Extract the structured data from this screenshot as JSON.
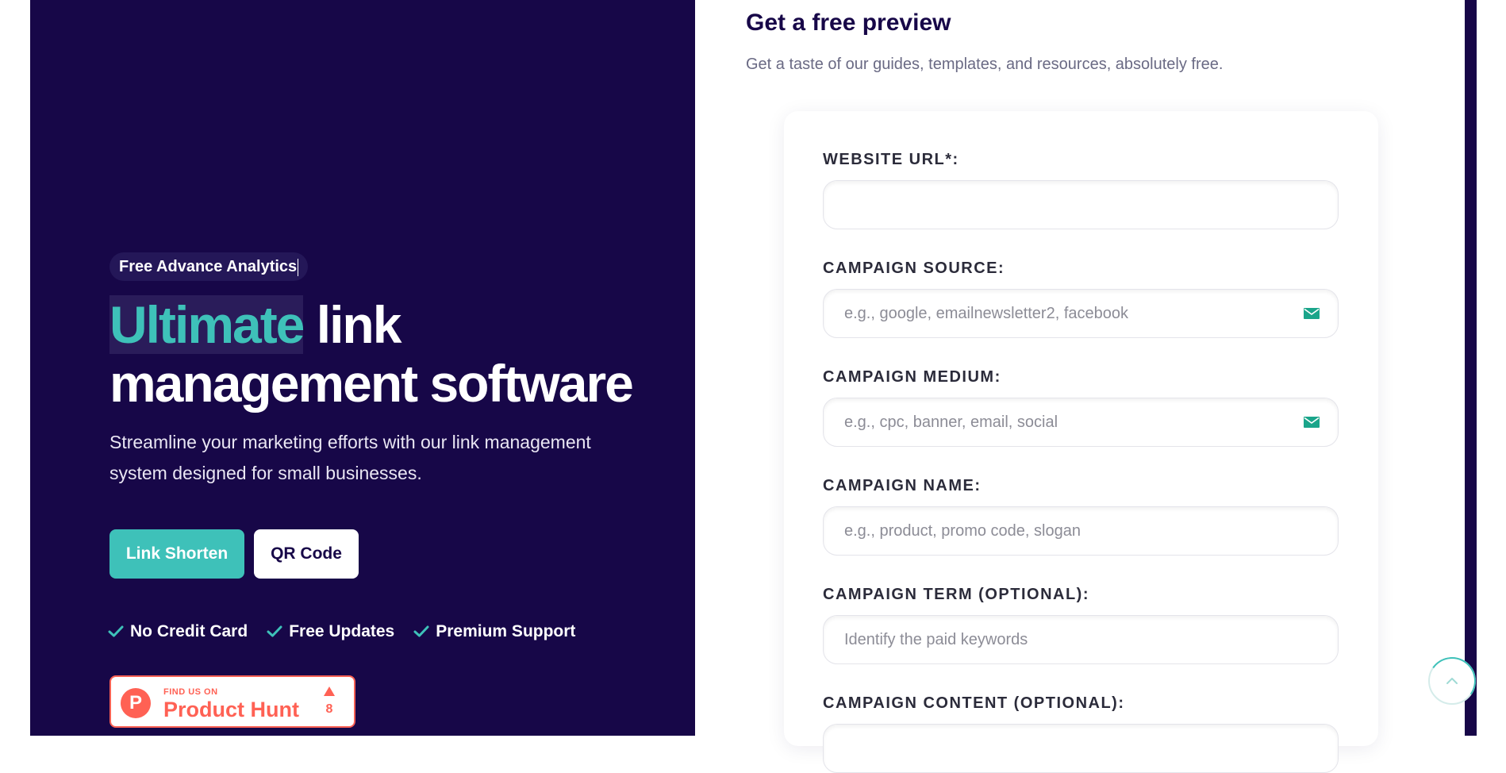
{
  "hero": {
    "badge": "Free Advance Analytics",
    "title_accent": "Ultimate",
    "title_line1_rest": "link",
    "title_line2": "management software",
    "subtitle": "Streamline your marketing efforts with our link management system designed for small businesses.",
    "primary_button": "Link Shorten",
    "secondary_button": "QR Code",
    "features": [
      "No Credit Card",
      "Free Updates",
      "Premium Support"
    ]
  },
  "product_hunt": {
    "small_text": "FIND US ON",
    "name": "Product Hunt",
    "logo_letter": "P",
    "upvotes": "8"
  },
  "preview": {
    "title": "Get a free preview",
    "subtitle": "Get a taste of our guides, templates, and resources, absolutely free."
  },
  "form": {
    "website_url": {
      "label": "WEBSITE URL*:",
      "placeholder": "",
      "value": ""
    },
    "campaign_source": {
      "label": "CAMPAIGN SOURCE:",
      "placeholder": "e.g., google, emailnewsletter2, facebook",
      "icon": "envelope-icon"
    },
    "campaign_medium": {
      "label": "CAMPAIGN MEDIUM:",
      "placeholder": "e.g., cpc, banner, email, social",
      "icon": "envelope-icon"
    },
    "campaign_name": {
      "label": "CAMPAIGN NAME:",
      "placeholder": "e.g., product, promo code, slogan"
    },
    "campaign_term": {
      "label": "CAMPAIGN TERM (OPTIONAL):",
      "placeholder": "Identify the paid keywords"
    },
    "campaign_content": {
      "label": "CAMPAIGN CONTENT (OPTIONAL):"
    }
  },
  "colors": {
    "navy": "#170748",
    "teal": "#3ec1b9",
    "product_hunt": "#ff6154"
  },
  "icons": {
    "check": "check-icon",
    "scroll_top": "chevron-up-icon"
  }
}
